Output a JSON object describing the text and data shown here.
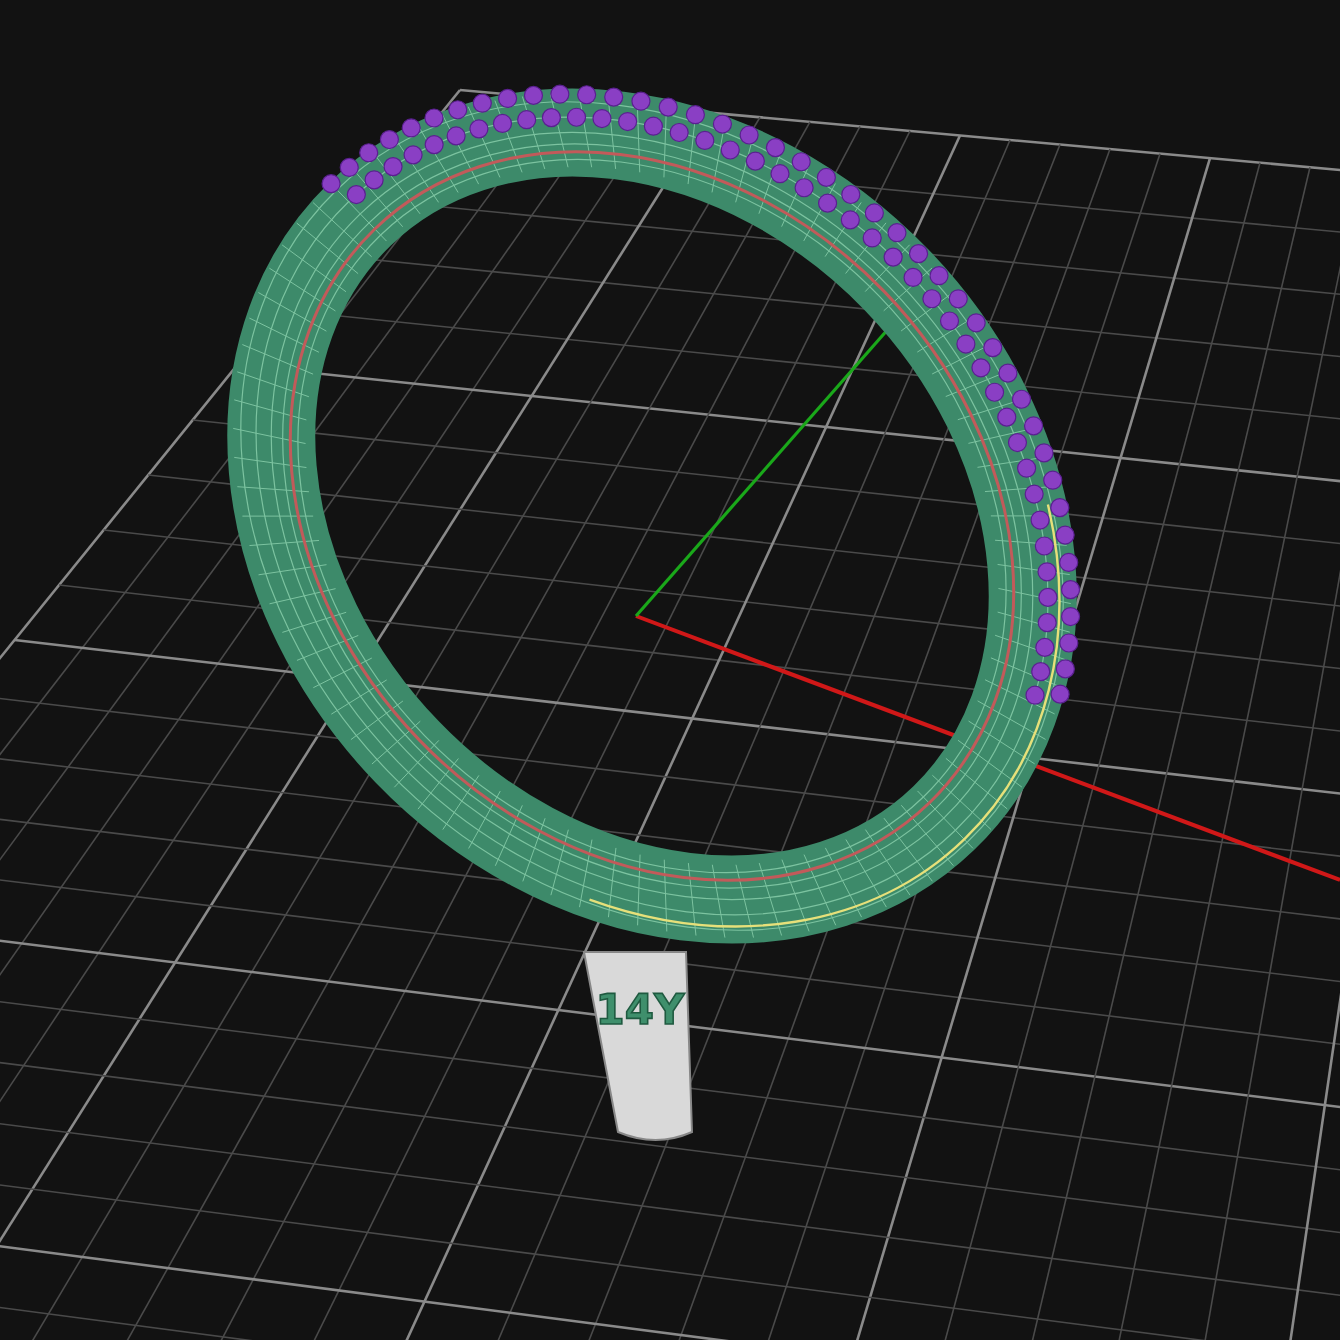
{
  "viewport": {
    "model_stamp": "14Y"
  }
}
